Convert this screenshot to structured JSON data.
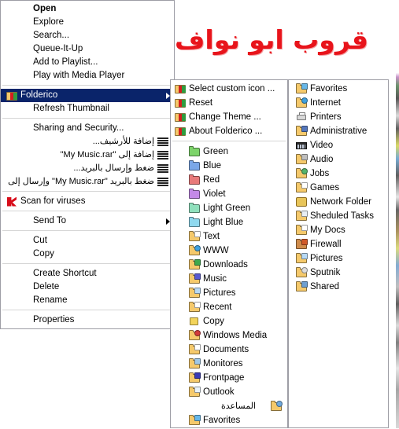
{
  "banner": {
    "text": "قروب ابو نواف",
    "color": "#e8141b"
  },
  "menu1": {
    "name": "file-context-menu",
    "items": [
      {
        "label": "Open",
        "icon": "none",
        "bold": true,
        "rtl": false
      },
      {
        "label": "Explore",
        "icon": "none",
        "bold": false,
        "rtl": false
      },
      {
        "label": "Search...",
        "icon": "none",
        "bold": false,
        "rtl": false
      },
      {
        "label": "Queue-It-Up",
        "icon": "none",
        "bold": false,
        "rtl": false
      },
      {
        "label": "Add to Playlist...",
        "icon": "none",
        "bold": false,
        "rtl": false
      },
      {
        "label": "Play with Media Player",
        "icon": "none",
        "bold": false,
        "rtl": false
      },
      {
        "separator": true
      },
      {
        "label": "Folderico",
        "icon": "folderico-app-icon",
        "selected": true,
        "submenu": true,
        "rtl": false
      },
      {
        "label": "Refresh Thumbnail",
        "icon": "none",
        "bold": false,
        "rtl": false
      },
      {
        "separator": true
      },
      {
        "label": "Sharing and Security...",
        "icon": "none",
        "bold": false,
        "rtl": false
      },
      {
        "label": "إضافة للأرشيف...",
        "icon": "winrar-icon",
        "rtl": true
      },
      {
        "label": "إضافة إلى \"My Music.rar\"",
        "icon": "winrar-icon",
        "rtl": true
      },
      {
        "label": "ضغط وإرسال بالبريد...",
        "icon": "winrar-icon",
        "rtl": true
      },
      {
        "label": "ضغط بالبريد \"My Music.rar\" وإرسال إلى",
        "icon": "winrar-icon",
        "rtl": true
      },
      {
        "separator": true
      },
      {
        "label": "Scan for viruses",
        "icon": "kaspersky-icon",
        "rtl": false
      },
      {
        "separator": true
      },
      {
        "label": "Send To",
        "icon": "none",
        "submenu": true,
        "rtl": false
      },
      {
        "separator": true
      },
      {
        "label": "Cut",
        "icon": "none",
        "rtl": false
      },
      {
        "label": "Copy",
        "icon": "none",
        "rtl": false
      },
      {
        "separator": true
      },
      {
        "label": "Create Shortcut",
        "icon": "none",
        "rtl": false
      },
      {
        "label": "Delete",
        "icon": "none",
        "rtl": false
      },
      {
        "label": "Rename",
        "icon": "none",
        "rtl": false
      },
      {
        "separator": true
      },
      {
        "label": "Properties",
        "icon": "none",
        "rtl": false
      }
    ]
  },
  "menu2": {
    "name": "folderico-submenu",
    "items": [
      {
        "label": "Select custom icon ...",
        "icon": "folderico-app-icon",
        "indent": false
      },
      {
        "label": "Reset",
        "icon": "folderico-app-icon",
        "indent": false
      },
      {
        "label": "Change Theme ...",
        "icon": "folderico-app-icon",
        "indent": false
      },
      {
        "label": "About Folderico ...",
        "icon": "folderico-app-icon",
        "indent": false
      },
      {
        "separator": true
      },
      {
        "label": "Green",
        "icon": "folder-green-icon",
        "indent": true
      },
      {
        "label": "Blue",
        "icon": "folder-blue-icon",
        "indent": true
      },
      {
        "label": "Red",
        "icon": "folder-red-icon",
        "indent": true
      },
      {
        "label": "Violet",
        "icon": "folder-violet-icon",
        "indent": true
      },
      {
        "label": "Light Green",
        "icon": "folder-light-green-icon",
        "indent": true
      },
      {
        "label": "Light Blue",
        "icon": "folder-light-blue-icon",
        "indent": true
      },
      {
        "label": "Text",
        "icon": "folder-text-icon",
        "indent": true
      },
      {
        "label": "WWW",
        "icon": "folder-www-icon",
        "indent": true
      },
      {
        "label": "Downloads",
        "icon": "folder-downloads-icon",
        "indent": true
      },
      {
        "label": "Music",
        "icon": "folder-music-icon",
        "indent": true
      },
      {
        "label": "Pictures",
        "icon": "folder-pictures-icon",
        "indent": true
      },
      {
        "label": "Recent",
        "icon": "folder-recent-icon",
        "indent": true
      },
      {
        "label": "Copy",
        "icon": "folder-copy-icon",
        "indent": true
      },
      {
        "label": "Windows Media",
        "icon": "folder-windows-media-icon",
        "indent": true
      },
      {
        "label": "Documents",
        "icon": "folder-documents-icon",
        "indent": true
      },
      {
        "label": "Monitores",
        "icon": "folder-monitores-icon",
        "indent": true
      },
      {
        "label": "Frontpage",
        "icon": "folder-frontpage-icon",
        "indent": true
      },
      {
        "label": "Outlook",
        "icon": "folder-outlook-icon",
        "indent": true
      },
      {
        "label": "المساعدة",
        "icon": "folder-help-icon",
        "indent": true,
        "rtl": true
      },
      {
        "label": "Favorites",
        "icon": "folder-favorites-icon",
        "indent": true
      }
    ]
  },
  "menu3": {
    "name": "folderico-themes-column",
    "items": [
      {
        "label": "Favorites",
        "icon": "folder-favorites-icon"
      },
      {
        "label": "Internet",
        "icon": "folder-internet-icon"
      },
      {
        "label": "Printers",
        "icon": "printer-icon"
      },
      {
        "label": "Administrative",
        "icon": "folder-administrative-icon"
      },
      {
        "label": "Video",
        "icon": "video-strip-icon"
      },
      {
        "label": "Audio",
        "icon": "folder-audio-icon"
      },
      {
        "label": "Jobs",
        "icon": "folder-jobs-icon"
      },
      {
        "label": "Games",
        "icon": "folder-games-icon"
      },
      {
        "label": "Network Folder",
        "icon": "network-folder-icon"
      },
      {
        "label": "Sheduled Tasks",
        "icon": "folder-scheduled-tasks-icon"
      },
      {
        "label": "My Docs",
        "icon": "folder-my-docs-icon"
      },
      {
        "label": "Firewall",
        "icon": "folder-firewall-icon"
      },
      {
        "label": "Pictures",
        "icon": "folder-pictures2-icon"
      },
      {
        "label": "Sputnik",
        "icon": "folder-sputnik-icon"
      },
      {
        "label": "Shared",
        "icon": "folder-shared-icon"
      }
    ]
  }
}
